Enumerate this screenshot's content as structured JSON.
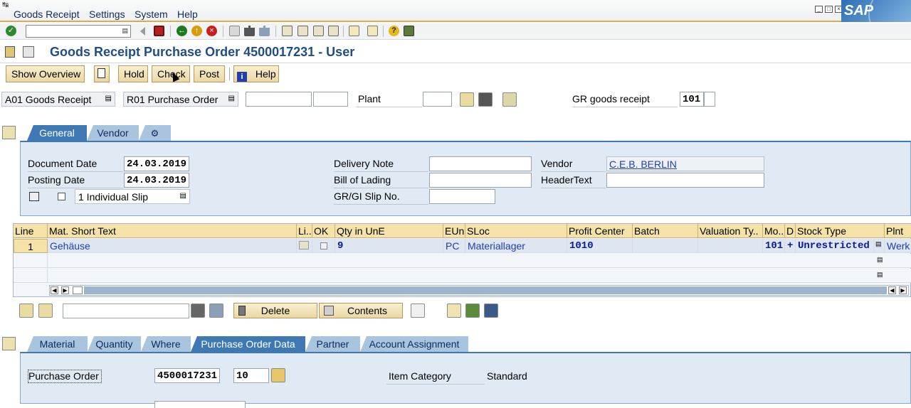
{
  "menubar": {
    "items": [
      "Goods Receipt",
      "Settings",
      "System",
      "Help"
    ],
    "logo": "SAP"
  },
  "toolbar": {
    "command_field": "",
    "icons": [
      "enter-icon",
      "save-icon",
      "back-icon",
      "exit-icon",
      "cancel-icon",
      "print-icon",
      "find-icon",
      "find-next-icon",
      "first-page-icon",
      "prev-page-icon",
      "next-page-icon",
      "last-page-icon",
      "new-session-icon",
      "shortcut-icon",
      "help-icon",
      "layout-icon"
    ]
  },
  "title": {
    "text": "Goods Receipt Purchase Order 4500017231 - User"
  },
  "appbar": {
    "show_overview": "Show Overview",
    "hold": "Hold",
    "check": "Check",
    "post": "Post",
    "help": "Help"
  },
  "header": {
    "action": "A01 Goods Receipt",
    "reference": "R01 Purchase Order",
    "po_number": "",
    "po_item": "",
    "plant_label": "Plant",
    "plant_value": "",
    "gr_label": "GR goods receipt",
    "movement_type": "101"
  },
  "header_tabs": [
    "General",
    "Vendor"
  ],
  "general": {
    "document_date_label": "Document Date",
    "document_date": "24.03.2019",
    "posting_date_label": "Posting Date",
    "posting_date": "24.03.2019",
    "slip_option": "1 Individual Slip",
    "delivery_note_label": "Delivery Note",
    "delivery_note": "",
    "bill_of_lading_label": "Bill of Lading",
    "bill_of_lading": "",
    "slip_no_label": "GR/GI Slip No.",
    "slip_no": "",
    "vendor_label": "Vendor",
    "vendor": "C.E.B. BERLIN",
    "header_text_label": "HeaderText",
    "header_text": ""
  },
  "grid": {
    "columns": [
      "Line",
      "Mat. Short Text",
      "Li..",
      "OK",
      "Qty in UnE",
      "EUn",
      "SLoc",
      "Profit Center",
      "Batch",
      "Valuation Ty..",
      "Mo...",
      "D",
      "Stock Type",
      "Plnt"
    ],
    "rows": [
      {
        "line": "1",
        "mat": "Gehäuse",
        "qty": "9",
        "eun": "PC",
        "sloc": "Materiallager",
        "profit_center": "1010",
        "batch": "",
        "valuation": "",
        "mvt": "101",
        "d": "+",
        "stock_type": "Unrestricted",
        "plant": "Werk"
      }
    ]
  },
  "gridbar": {
    "search": "",
    "delete": "Delete",
    "contents": "Contents"
  },
  "item_tabs": [
    "Material",
    "Quantity",
    "Where",
    "Purchase Order Data",
    "Partner",
    "Account Assignment"
  ],
  "item": {
    "po_label": "Purchase Order",
    "po_number": "4500017231",
    "po_item": "10",
    "category_label": "Item Category",
    "category": "Standard"
  },
  "colors": {
    "tab_active": "#3f79b3",
    "tab_inactive": "#a9c4df",
    "panel": "#e0eaf4",
    "button": "#ead7a3",
    "title": "#1f4e86",
    "grid_header": "#f5e2a8"
  }
}
